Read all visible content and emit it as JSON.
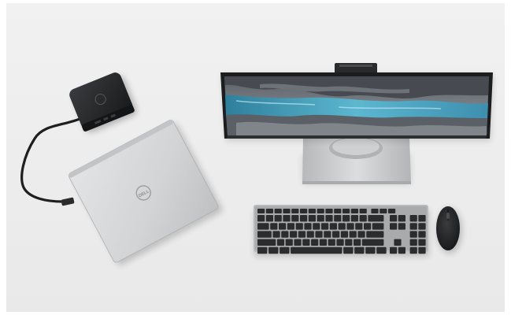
{
  "scene": {
    "logo_text": "DELL",
    "colors": {
      "page_background": "#ffffff",
      "backdrop": "#eeeeee",
      "laptop_silver": "#d4d5d7",
      "dock_black": "#262729",
      "monitor_bezel": "#1c1d1f",
      "stand_silver": "#c9cacc",
      "keyboard_frame": "#b9babc",
      "key_dark": "#2b2c2e",
      "mouse_black": "#222325",
      "water_blue": "#4aa7c4"
    },
    "icons": [
      "dock-icon",
      "laptop-icon",
      "monitor-icon",
      "keyboard-icon",
      "mouse-icon",
      "cable-icon",
      "logo-icon"
    ]
  }
}
